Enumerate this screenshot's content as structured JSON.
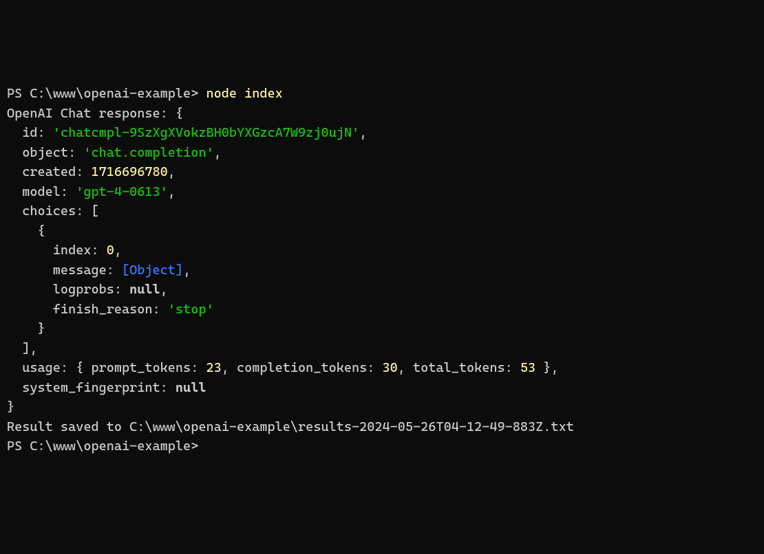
{
  "line1": {
    "prompt": "PS C:\\www\\openai-example> ",
    "command": "node index"
  },
  "line2": "OpenAI Chat response: {",
  "line3": {
    "prefix": "  id: ",
    "value": "'chatcmpl-9SzXgXVokzBH0bYXGzcA7W9zj0ujN'",
    "suffix": ","
  },
  "line4": {
    "prefix": "  object: ",
    "value": "'chat.completion'",
    "suffix": ","
  },
  "line5": {
    "prefix": "  created: ",
    "value": "1716696780",
    "suffix": ","
  },
  "line6": {
    "prefix": "  model: ",
    "value": "'gpt-4-0613'",
    "suffix": ","
  },
  "line7": "  choices: [",
  "line8": "    {",
  "line9": {
    "prefix": "      index: ",
    "value": "0",
    "suffix": ","
  },
  "line10": {
    "prefix": "      message: ",
    "value": "[Object]",
    "suffix": ","
  },
  "line11": {
    "prefix": "      logprobs: ",
    "value": "null",
    "suffix": ","
  },
  "line12": {
    "prefix": "      finish_reason: ",
    "value": "'stop'",
    "suffix": ""
  },
  "line13": "    }",
  "line14": "  ],",
  "line15": {
    "prefix": "  usage: { prompt_tokens: ",
    "v1": "23",
    "mid1": ", completion_tokens: ",
    "v2": "30",
    "mid2": ", total_tokens: ",
    "v3": "53",
    "suffix": " },"
  },
  "line16": {
    "prefix": "  system_fingerprint: ",
    "value": "null",
    "suffix": ""
  },
  "line17": "}",
  "line18": "Result saved to C:\\www\\openai-example\\results-2024-05-26T04-12-49-883Z.txt",
  "line19": {
    "prompt": "PS C:\\www\\openai-example>"
  }
}
